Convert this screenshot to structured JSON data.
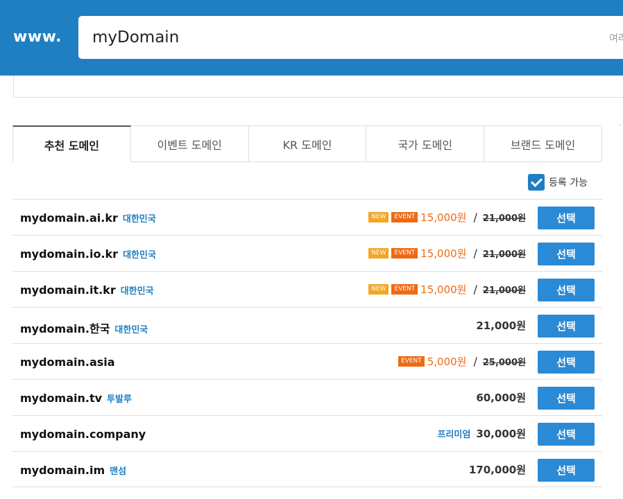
{
  "header": {
    "prefix": "www.",
    "search_value": "myDomain",
    "search_hint": "여러",
    "color": "#1f7fc2"
  },
  "tabs": [
    {
      "label": "추천 도메인",
      "active": true
    },
    {
      "label": "이벤트 도메인",
      "active": false
    },
    {
      "label": "KR 도메인",
      "active": false
    },
    {
      "label": "국가 도메인",
      "active": false
    },
    {
      "label": "브랜드 도메인",
      "active": false
    }
  ],
  "filter": {
    "label": "등록 가능",
    "checked": true
  },
  "rows": [
    {
      "domain": "mydomain.ai.kr",
      "country": "대한민국",
      "badges": [
        "NEW",
        "EVENT"
      ],
      "sale_price": "15,000원",
      "original_price": "21,000원",
      "button": "선택"
    },
    {
      "domain": "mydomain.io.kr",
      "country": "대한민국",
      "badges": [
        "NEW",
        "EVENT"
      ],
      "sale_price": "15,000원",
      "original_price": "21,000원",
      "button": "선택"
    },
    {
      "domain": "mydomain.it.kr",
      "country": "대한민국",
      "badges": [
        "NEW",
        "EVENT"
      ],
      "sale_price": "15,000원",
      "original_price": "21,000원",
      "button": "선택"
    },
    {
      "domain": "mydomain.한국",
      "country": "대한민국",
      "price": "21,000원",
      "button": "선택"
    },
    {
      "domain": "mydomain.asia",
      "badges": [
        "EVENT"
      ],
      "sale_price": "5,000원",
      "original_price": "25,000원",
      "button": "선택"
    },
    {
      "domain": "mydomain.tv",
      "country": "투발루",
      "price": "60,000원",
      "button": "선택"
    },
    {
      "domain": "mydomain.company",
      "tag": "프리미엄",
      "price": "30,000원",
      "button": "선택"
    },
    {
      "domain": "mydomain.im",
      "country": "맨섬",
      "price": "170,000원",
      "button": "선택"
    }
  ],
  "colors": {
    "accent": "#2a8ad6",
    "sale": "#ee6a13",
    "new_badge": "#f5a623"
  }
}
